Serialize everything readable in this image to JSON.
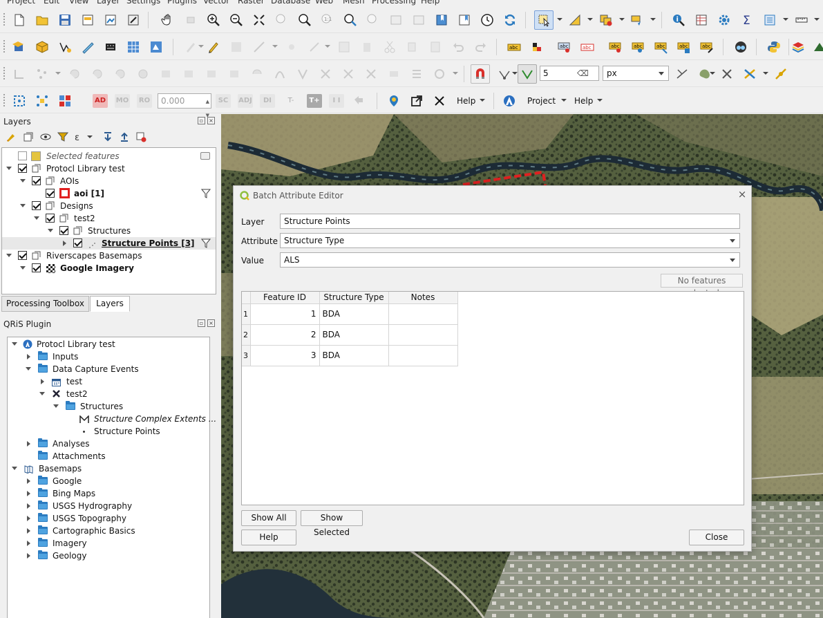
{
  "menubar": [
    "Project",
    "Edit",
    "View",
    "Layer",
    "Settings",
    "Plugins",
    "Vector",
    "Raster",
    "Database",
    "Web",
    "Mesh",
    "Processing",
    "Help"
  ],
  "toolbar4": {
    "offset_value": "0.000",
    "chips": [
      "AD",
      "MO",
      "RO",
      "SC",
      "ADJ",
      "DI",
      "T-",
      "T+",
      "I I"
    ],
    "help_label_1": "Help",
    "project_label": "Project",
    "help_label_2": "Help"
  },
  "snapping": {
    "tolerance": "5",
    "unit": "px"
  },
  "layers_panel": {
    "title": "Layers",
    "items": [
      {
        "label": "Selected features"
      },
      {
        "label": "Protocl Library test"
      },
      {
        "label": "AOIs"
      },
      {
        "label": "aoi [1]"
      },
      {
        "label": "Designs"
      },
      {
        "label": "test2"
      },
      {
        "label": "Structures"
      },
      {
        "label": "Structure Points [3]"
      },
      {
        "label": "Riverscapes Basemaps"
      },
      {
        "label": "Google Imagery"
      }
    ],
    "tabs": [
      "Processing Toolbox",
      "Layers"
    ]
  },
  "qris_panel": {
    "title": "QRiS Plugin",
    "items": [
      {
        "label": "Protocl Library test"
      },
      {
        "label": "Inputs"
      },
      {
        "label": "Data Capture Events"
      },
      {
        "label": "test"
      },
      {
        "label": "test2"
      },
      {
        "label": "Structures"
      },
      {
        "label": "Structure Complex Extents ..."
      },
      {
        "label": "Structure Points"
      },
      {
        "label": "Analyses"
      },
      {
        "label": "Attachments"
      },
      {
        "label": "Basemaps"
      },
      {
        "label": "Google"
      },
      {
        "label": "Bing Maps"
      },
      {
        "label": "USGS Hydrography"
      },
      {
        "label": "USGS Topography"
      },
      {
        "label": "Cartographic Basics"
      },
      {
        "label": "Imagery"
      },
      {
        "label": "Geology"
      }
    ]
  },
  "dialog": {
    "title": "Batch Attribute Editor",
    "layer_label": "Layer",
    "layer_value": "Structure Points",
    "attribute_label": "Attribute",
    "attribute_value": "Structure Type",
    "value_label": "Value",
    "value_value": "ALS",
    "selection_status": "No features selected",
    "columns": [
      "Feature ID",
      "Structure Type",
      "Notes"
    ],
    "rows": [
      {
        "row": "1",
        "id": "1",
        "type": "BDA",
        "notes": ""
      },
      {
        "row": "2",
        "id": "2",
        "type": "BDA",
        "notes": ""
      },
      {
        "row": "3",
        "id": "3",
        "type": "BDA",
        "notes": ""
      }
    ],
    "show_all_button": "Show All",
    "show_selected_button": "Show Selected",
    "help_button": "Help",
    "close_button": "Close"
  },
  "colors": {
    "aoi_outline": "#e02020",
    "accent_folder": "#2b7bc0"
  }
}
